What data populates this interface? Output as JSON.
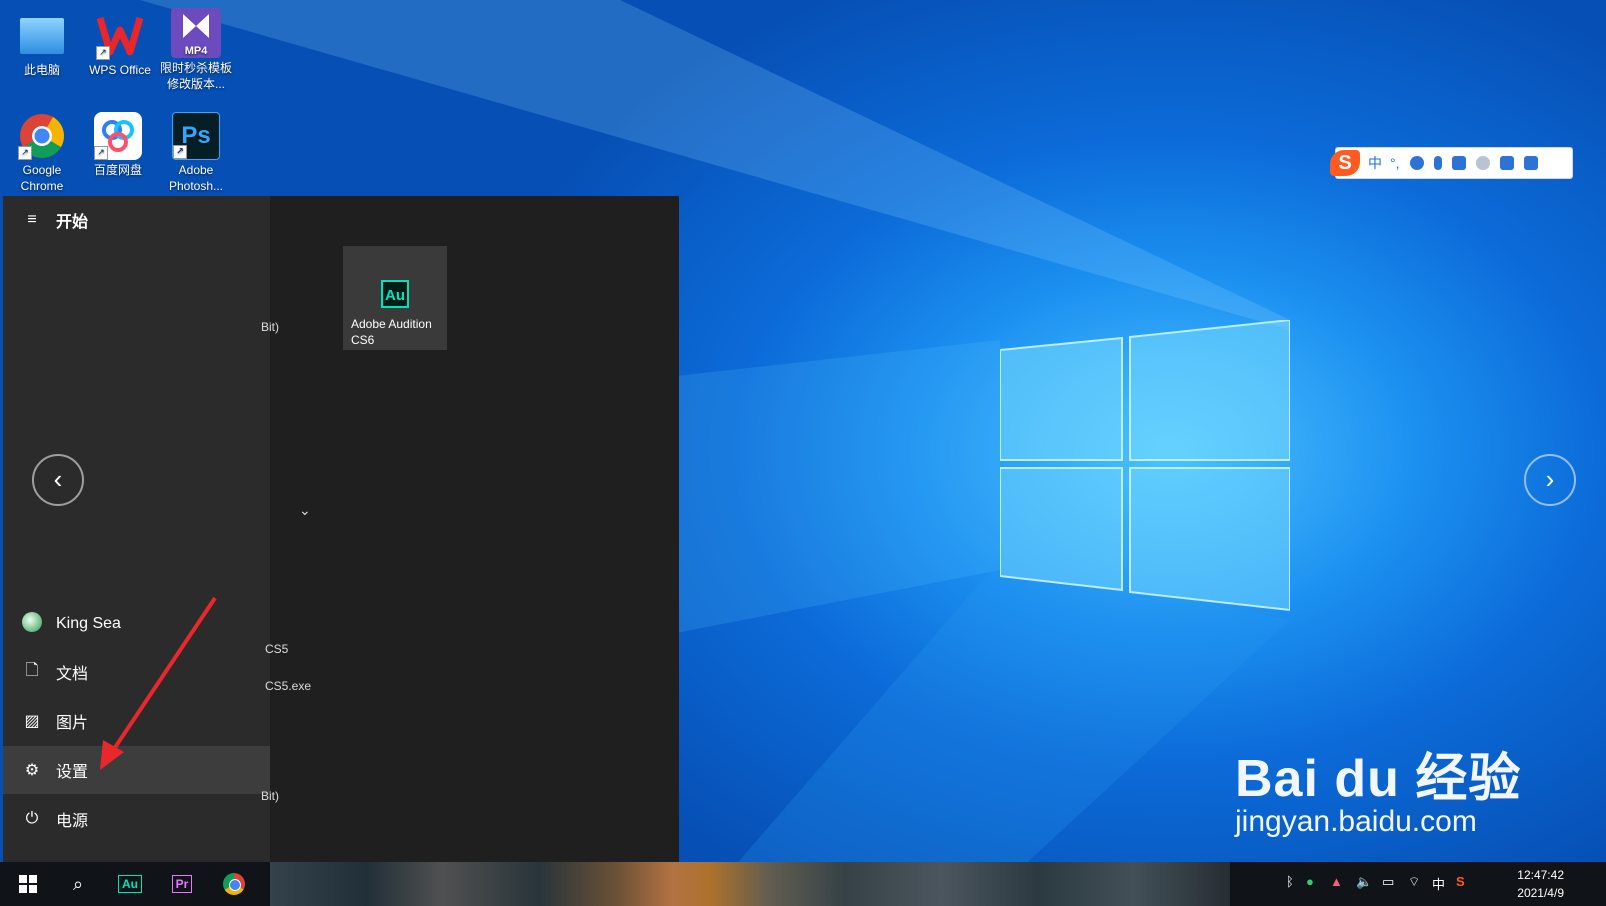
{
  "desktop": {
    "icons": [
      {
        "label": "此电脑"
      },
      {
        "label": "WPS Office"
      },
      {
        "label": "限时秒杀模板修改版本..."
      },
      {
        "label": "Google Chrome"
      },
      {
        "label": "百度网盘"
      },
      {
        "label": "Adobe Photosh..."
      }
    ]
  },
  "ime_toolbar": {
    "mode": "中",
    "punct": "°,"
  },
  "start_menu": {
    "header": "开始",
    "user": "King Sea",
    "items": [
      {
        "label": "文档",
        "icon": "document-icon"
      },
      {
        "label": "图片",
        "icon": "picture-icon"
      },
      {
        "label": "设置",
        "icon": "gear-icon"
      },
      {
        "label": "电源",
        "icon": "power-icon"
      }
    ],
    "fragments": [
      "Bit)",
      "CS5",
      "CS5.exe",
      "Bit)"
    ],
    "tile": {
      "label": "Adobe Audition CS6",
      "icon_text": "Au"
    }
  },
  "taskbar": {
    "apps": [
      {
        "name": "Au"
      },
      {
        "name": "Pr"
      }
    ],
    "ime_indicator": "中",
    "time": "12:47:42",
    "date": "2021/4/9"
  },
  "watermark": {
    "brand": "Bai du 经验",
    "url": "jingyan.baidu.com"
  },
  "colors": {
    "accent": "#0a6fd6",
    "start_bg": "#1f1f1f",
    "start_left": "#2b2b2b",
    "arrow": "#e8282b"
  }
}
